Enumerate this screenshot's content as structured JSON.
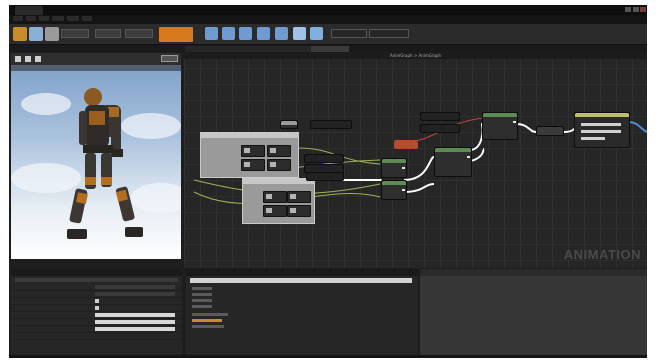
{
  "graph": {
    "header": "AnimGraph > AnimGraph",
    "watermark": "ANIMATION"
  },
  "toolbar": {
    "compile_label": ""
  },
  "colors": {
    "accent_compile": "#d9791e",
    "wire_exec": "#ffffff",
    "node_green_header": "#5f8a56",
    "node_pose_header": "#a8a8a8",
    "node_red_header": "#b05030"
  },
  "icons": [
    "save-icon",
    "find-icon",
    "compile-icon",
    "play-icon",
    "settings-icon"
  ]
}
